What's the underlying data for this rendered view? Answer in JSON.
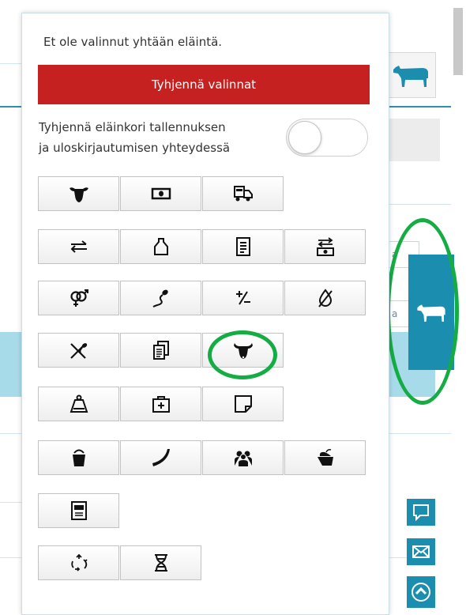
{
  "animal_basket": {
    "info_text": "Et ole valinnut yhtään eläintä.",
    "clear_button_label": "Tyhjennä valinnat",
    "toggle_label_line1": "Tyhjennä eläinkori tallennuksen",
    "toggle_label_line2": "ja uloskirjautumisen yhteydessä",
    "toggle_on": false
  },
  "icon_rows": [
    [
      "animal-head-icon",
      "banknote-icon",
      "truck-icon"
    ],
    [
      "swap-arrows-icon",
      "weight-tag-icon",
      "document-icon",
      "money-transfer-icon"
    ],
    [
      "gender-icon",
      "sperm-icon",
      "plus-minus-icon",
      "no-drop-icon"
    ],
    [
      "no-insemination-icon",
      "documents-icon",
      "cow-head-icon"
    ],
    [
      "scale-weight-icon",
      "first-aid-kit-icon",
      "note-icon"
    ],
    [
      "bucket-icon",
      "horn-icon",
      "group-icon",
      "feed-icon"
    ],
    [
      "animal-card-icon"
    ],
    [
      "recycle-icon",
      "dna-icon"
    ]
  ],
  "colors": {
    "accent_red": "#c52121",
    "accent_teal": "#1b8eaf",
    "annotation_green": "#15ad43"
  },
  "background": {
    "tab_a1": "a",
    "tab_a2": "a"
  }
}
